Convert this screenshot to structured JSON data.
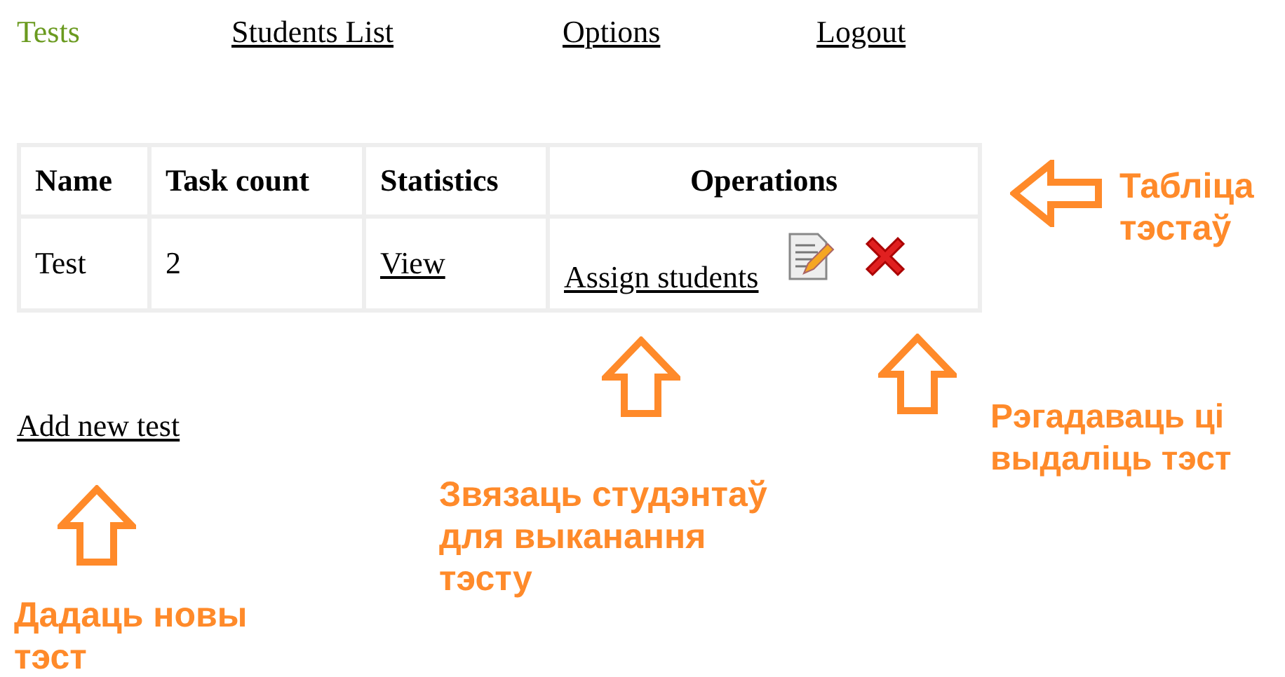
{
  "nav": [
    {
      "label": "Tests",
      "selected": true
    },
    {
      "label": "Students List",
      "selected": false
    },
    {
      "label": "Options",
      "selected": false
    },
    {
      "label": "Logout",
      "selected": false
    }
  ],
  "table": {
    "columns": [
      "Name",
      "Task count",
      "Statistics",
      "Operations"
    ],
    "rows": [
      {
        "name": "Test",
        "task_count": "2",
        "statistics_link": "View",
        "operations_link": "Assign students"
      }
    ]
  },
  "add_link": "Add new test",
  "annotations": [
    {
      "kind": "left",
      "lines": [
        "Табліца",
        "тэстаў"
      ]
    },
    {
      "kind": "up",
      "lines": [
        "Звязаць студэнтаў",
        "для выканання",
        "тэсту"
      ]
    },
    {
      "kind": "up",
      "lines": [
        "Рэгадаваць ці",
        "выдаліць тэст"
      ]
    },
    {
      "kind": "up",
      "lines": [
        "Дадаць новы",
        "тэст"
      ]
    }
  ]
}
